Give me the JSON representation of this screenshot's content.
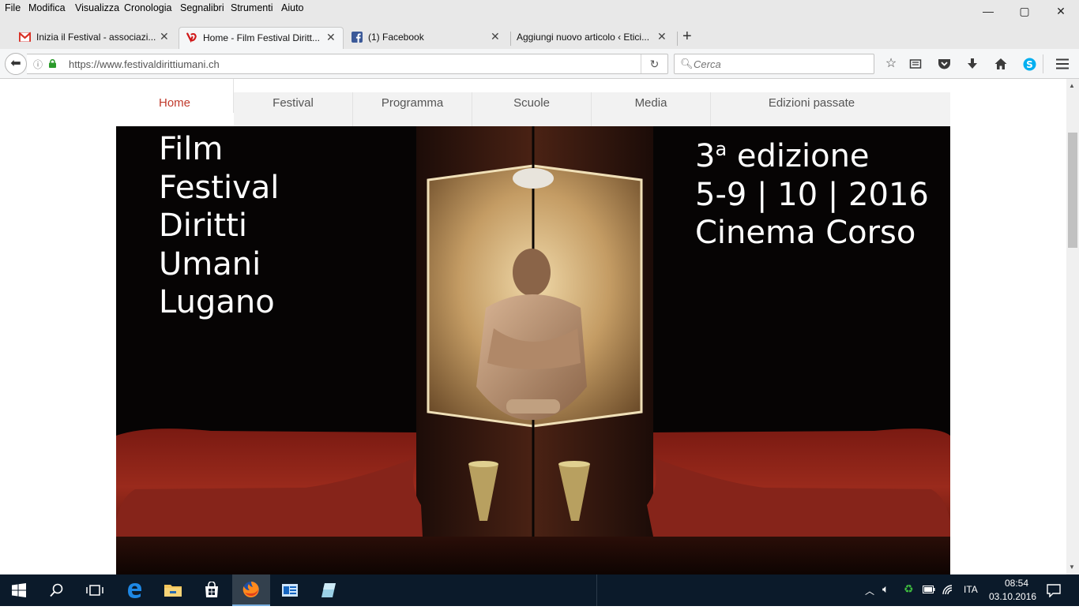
{
  "menu": [
    "File",
    "Modifica",
    "Visualizza",
    "Cronologia",
    "Segnalibri",
    "Strumenti",
    "Aiuto"
  ],
  "window_controls": {
    "minimize": "—",
    "maximize": "▢",
    "close": "✕"
  },
  "tabs": [
    {
      "title": "Inizia il Festival - associazi...",
      "icon": "gmail-icon"
    },
    {
      "title": "Home - Film Festival Diritt...",
      "icon": "ffdul-logo-icon",
      "active": true
    },
    {
      "title": "(1) Facebook",
      "icon": "facebook-icon"
    },
    {
      "title": "Aggiungi nuovo articolo ‹ Etici...",
      "icon": ""
    }
  ],
  "new_tab": "+",
  "address": {
    "url": "https://www.festivaldirittiumani.ch"
  },
  "search": {
    "placeholder": "Cerca"
  },
  "site_nav": [
    "Home",
    "Festival",
    "Programma",
    "Scuole",
    "Media",
    "Edizioni passate"
  ],
  "hero": {
    "title_lines": [
      "Film",
      "Festival",
      "Diritti",
      "Umani",
      "Lugano"
    ],
    "edition_num": "3",
    "edition_sup": "a",
    "edition_word": " edizione",
    "dates": "5-9 | 10 | 2016",
    "venue": "Cinema Corso"
  },
  "taskbar": {
    "lang": "ITA",
    "time": "08:54",
    "date": "03.10.2016"
  },
  "colors": {
    "accent_red": "#c0392b",
    "taskbar": "#0b1a2a",
    "chrome": "#e8e8e8"
  }
}
